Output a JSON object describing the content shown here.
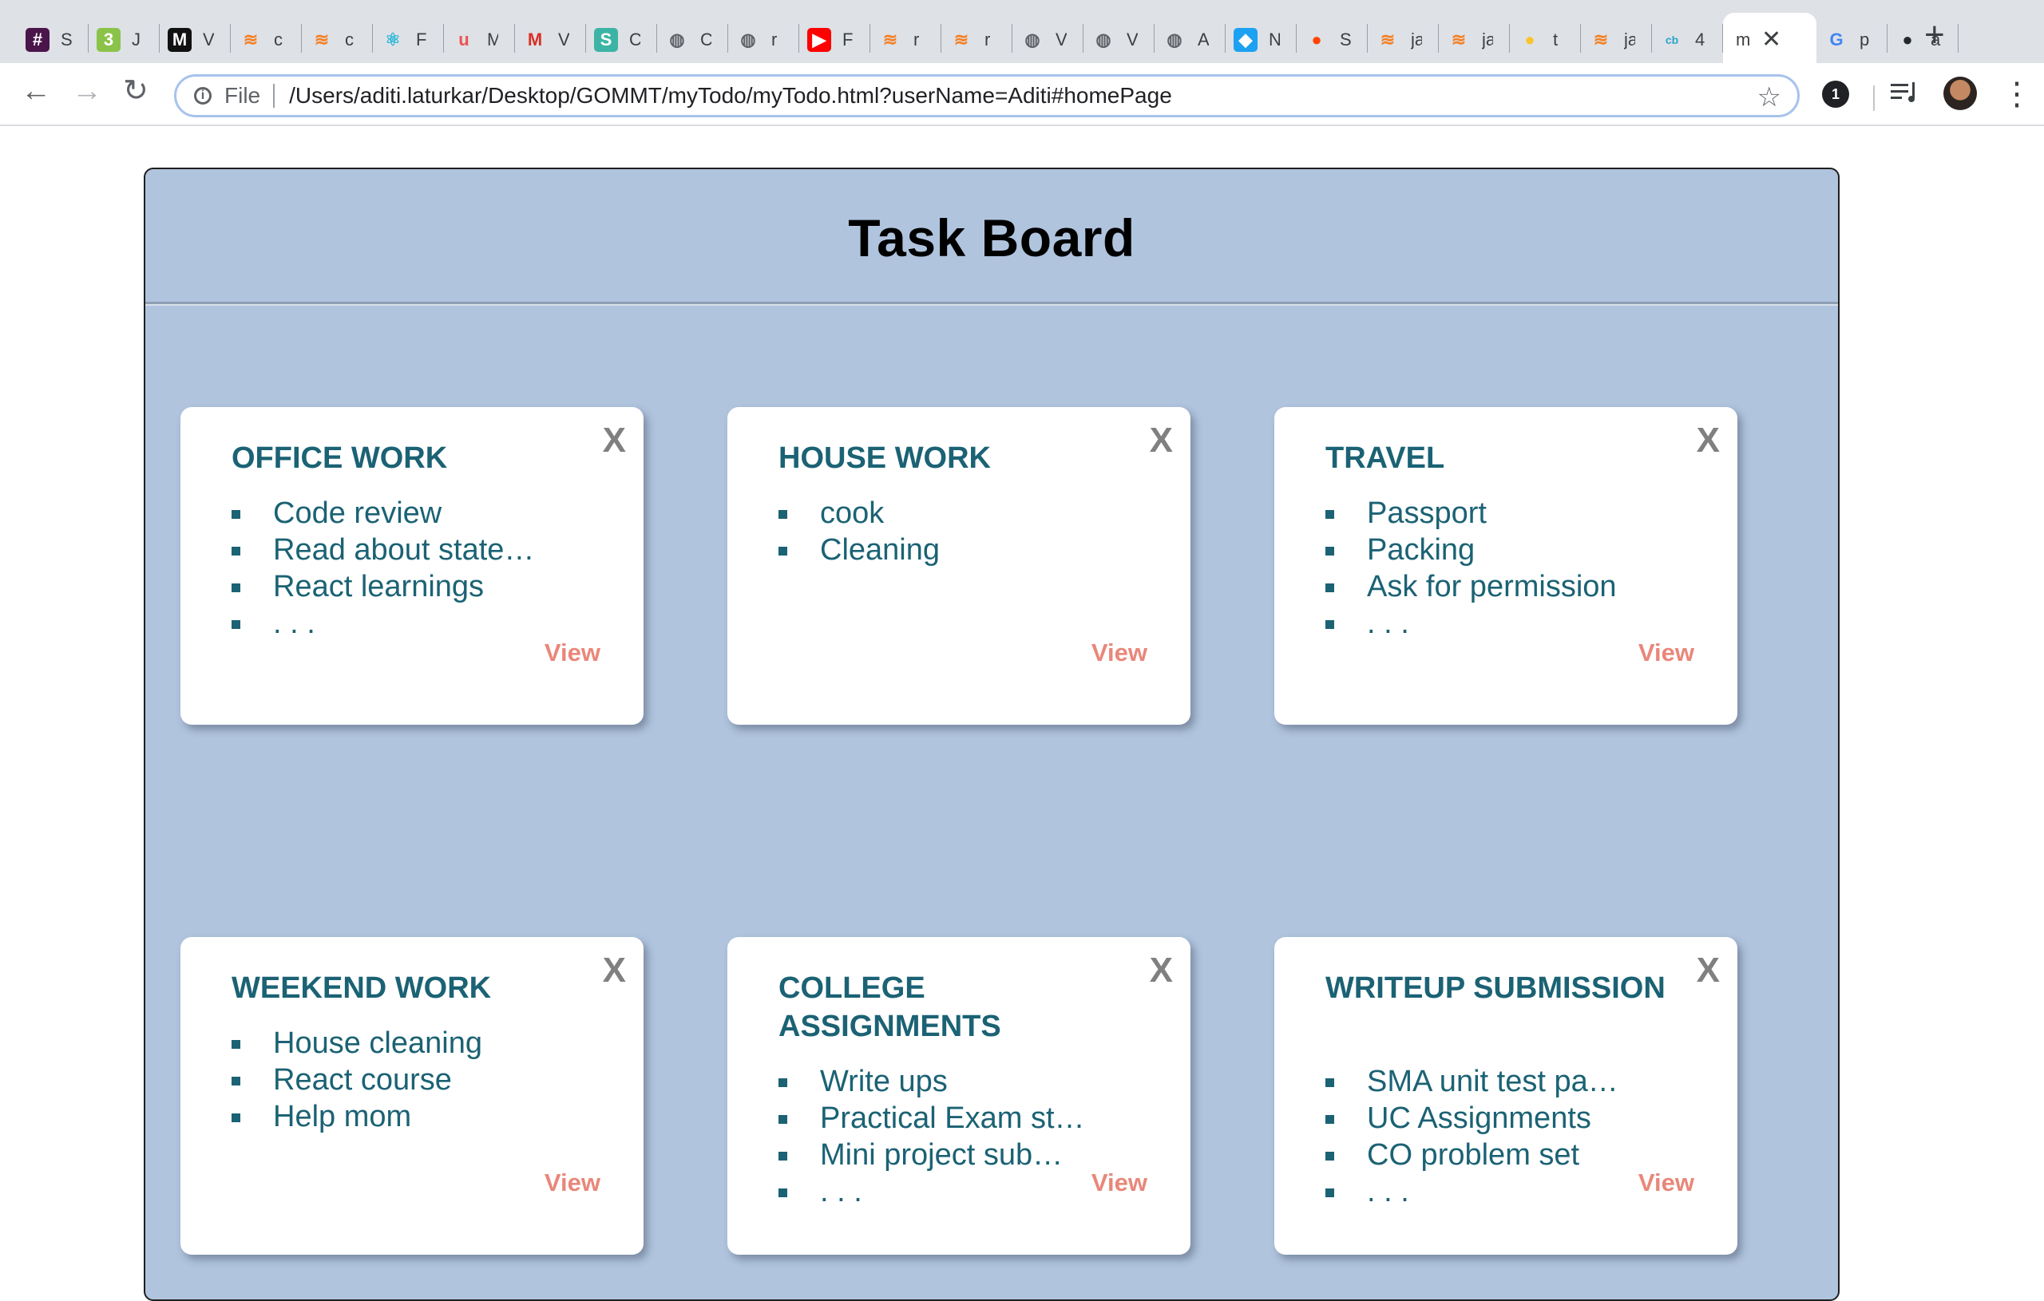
{
  "browser": {
    "tabs": [
      {
        "title": "S",
        "icon": "slack-icon",
        "color": "#4a154b"
      },
      {
        "title": "J",
        "icon": "w3schools-icon",
        "color": "#8bc34a"
      },
      {
        "title": "V",
        "icon": "medium-icon",
        "color": "#111111"
      },
      {
        "title": "c",
        "icon": "stackoverflow-icon",
        "color": "#f48024"
      },
      {
        "title": "c",
        "icon": "stackoverflow-icon",
        "color": "#f48024"
      },
      {
        "title": "F",
        "icon": "react-icon",
        "color": "#33b9d8"
      },
      {
        "title": "M",
        "icon": "udemy-icon",
        "color": "#ec5252"
      },
      {
        "title": "V",
        "icon": "gmail-icon",
        "color": "#d93025"
      },
      {
        "title": "C",
        "icon": "s-app-icon",
        "color": "#3cb4a5"
      },
      {
        "title": "C",
        "icon": "globe-icon",
        "color": "#5f6368"
      },
      {
        "title": "r",
        "icon": "globe-icon",
        "color": "#5f6368"
      },
      {
        "title": "F",
        "icon": "youtube-icon",
        "color": "#ff0000"
      },
      {
        "title": "r",
        "icon": "stackoverflow-icon",
        "color": "#f48024"
      },
      {
        "title": "r",
        "icon": "stackoverflow-icon",
        "color": "#f48024"
      },
      {
        "title": "V",
        "icon": "globe-icon",
        "color": "#5f6368"
      },
      {
        "title": "V",
        "icon": "globe-icon",
        "color": "#5f6368"
      },
      {
        "title": "A",
        "icon": "globe-icon",
        "color": "#5f6368"
      },
      {
        "title": "N",
        "icon": "bird-icon",
        "color": "#1da1f2"
      },
      {
        "title": "S",
        "icon": "reddit-icon",
        "color": "#ff4500"
      },
      {
        "title": "ja",
        "icon": "stackoverflow-icon",
        "color": "#f48024"
      },
      {
        "title": "ja",
        "icon": "stackoverflow-icon",
        "color": "#f48024"
      },
      {
        "title": "t",
        "icon": "bulb-icon",
        "color": "#f9c52b"
      },
      {
        "title": "ja",
        "icon": "stackoverflow-icon",
        "color": "#f48024"
      },
      {
        "title": "4",
        "icon": "cb-icon",
        "color": "#2ba6cb"
      },
      {
        "title": "m",
        "icon": "page-icon",
        "color": "#5f6368",
        "active": true
      },
      {
        "title": "p",
        "icon": "google-icon",
        "color": "#4285f4"
      },
      {
        "title": "a",
        "icon": "github-icon",
        "color": "#24292e"
      }
    ],
    "new_tab": "+",
    "close_tab": "✕",
    "url_scheme_label": "File",
    "url": "/Users/aditi.laturkar/Desktop/GOMMT/myTodo/myTodo.html?userName=Aditi#homePage",
    "extension_badge": "1"
  },
  "board": {
    "title": "Task Board",
    "cards": [
      {
        "title": "OFFICE WORK",
        "items": [
          "Code review",
          "Read about state…",
          "React learnings",
          ". . ."
        ],
        "close": "X",
        "view": "View"
      },
      {
        "title": "HOUSE WORK",
        "items": [
          "cook",
          "Cleaning"
        ],
        "close": "X",
        "view": "View"
      },
      {
        "title": "TRAVEL",
        "items": [
          "Passport",
          "Packing",
          "Ask for permission",
          ". . ."
        ],
        "close": "X",
        "view": "View"
      },
      {
        "title": "WEEKEND WORK",
        "items": [
          "House cleaning",
          "React course",
          "Help mom"
        ],
        "close": "X",
        "view": "View"
      },
      {
        "title": "COLLEGE ASSIGNMENTS",
        "items": [
          "Write ups",
          "Practical Exam st…",
          "Mini project sub…",
          ". . ."
        ],
        "close": "X",
        "view": "View"
      },
      {
        "title": "WRITEUP SUBMISSION",
        "items": [
          "SMA unit test pa…",
          "UC Assignments",
          "CO problem set",
          ". . ."
        ],
        "close": "X",
        "view": "View"
      }
    ]
  }
}
